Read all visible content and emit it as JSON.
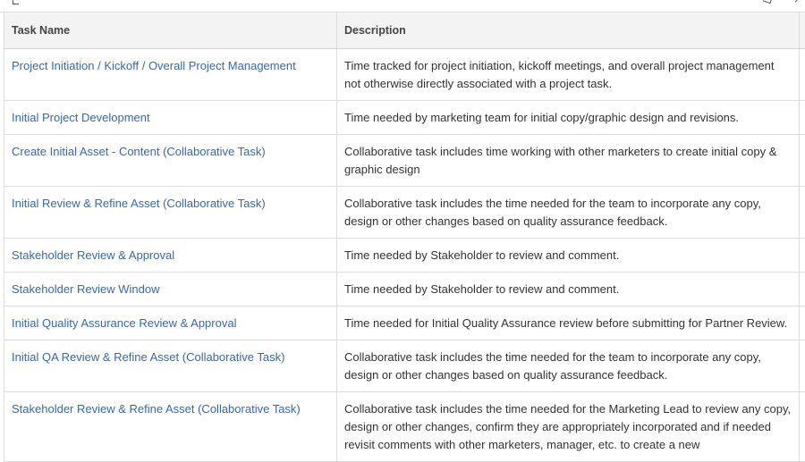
{
  "table": {
    "headers": {
      "task_name": "Task Name",
      "description": "Description"
    },
    "rows": [
      {
        "name": "Project Initiation / Kickoff / Overall Project Management",
        "description": "Time tracked for project initiation, kickoff meetings, and overall project management not otherwise directly associated with a project task."
      },
      {
        "name": "Initial Project Development",
        "description": "Time needed by marketing team for initial copy/graphic design and revisions."
      },
      {
        "name": "Create Initial Asset - Content (Collaborative Task)",
        "description": "Collaborative task includes time working with other marketers to create initial copy & graphic design"
      },
      {
        "name": "Initial Review & Refine Asset (Collaborative Task)",
        "description": "Collaborative task includes the time needed for the team to incorporate any copy, design or other changes based on quality assurance feedback."
      },
      {
        "name": "Stakeholder Review & Approval",
        "description": "Time needed by Stakeholder to review and comment."
      },
      {
        "name": "Stakeholder Review Window",
        "description": "Time needed by Stakeholder to review and comment."
      },
      {
        "name": "Initial Quality Assurance Review & Approval",
        "description": "Time needed for Initial Quality Assurance review before submitting for Partner Review."
      },
      {
        "name": "Initial QA Review & Refine Asset (Collaborative Task)",
        "description": "Collaborative task includes the time needed for the team to incorporate any copy, design or other changes based on quality assurance feedback."
      },
      {
        "name": "Stakeholder Review & Refine Asset (Collaborative Task)",
        "description": "Collaborative task includes the time needed for the Marketing Lead to review any copy, design or other changes, confirm they are appropriately incorporated and if needed revisit comments with other marketers, manager, etc. to create a new"
      }
    ]
  }
}
